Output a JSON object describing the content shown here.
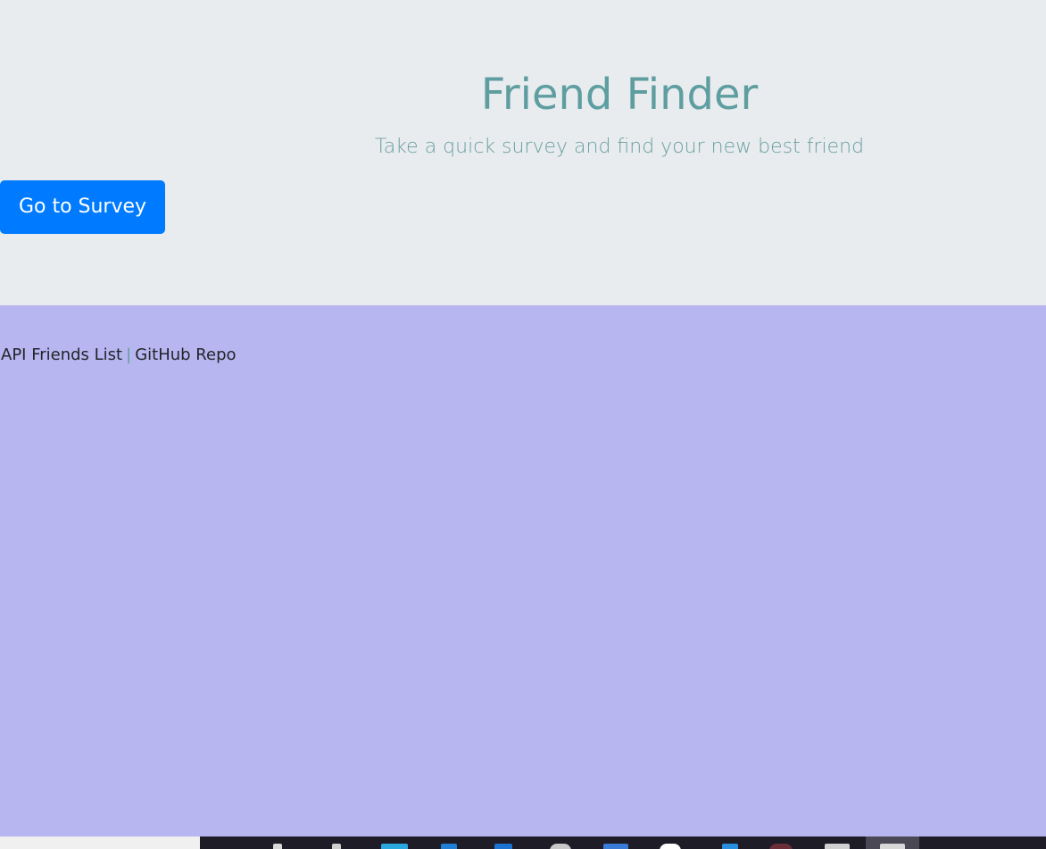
{
  "header": {
    "title": "Friend Finder",
    "subtitle": "Take a quick survey and find your new best friend"
  },
  "actions": {
    "survey_button": "Go to Survey"
  },
  "footer": {
    "api_link": "API Friends List",
    "separator": "|",
    "github_link": "GitHub Repo"
  },
  "colors": {
    "jumbotron_bg": "#e9ecef",
    "page_bg": "#b7b6f0",
    "title": "#5f9ea0",
    "button": "#007bff"
  },
  "taskbar": {
    "icons": [
      "file-explorer-icon",
      "pen-icon",
      "store-icon",
      "vscode-icon",
      "edge-icon",
      "chrome-icon",
      "code-icon",
      "chat-icon",
      "azure-icon",
      "app-icon",
      "terminal-icon",
      "browser-icon"
    ]
  }
}
